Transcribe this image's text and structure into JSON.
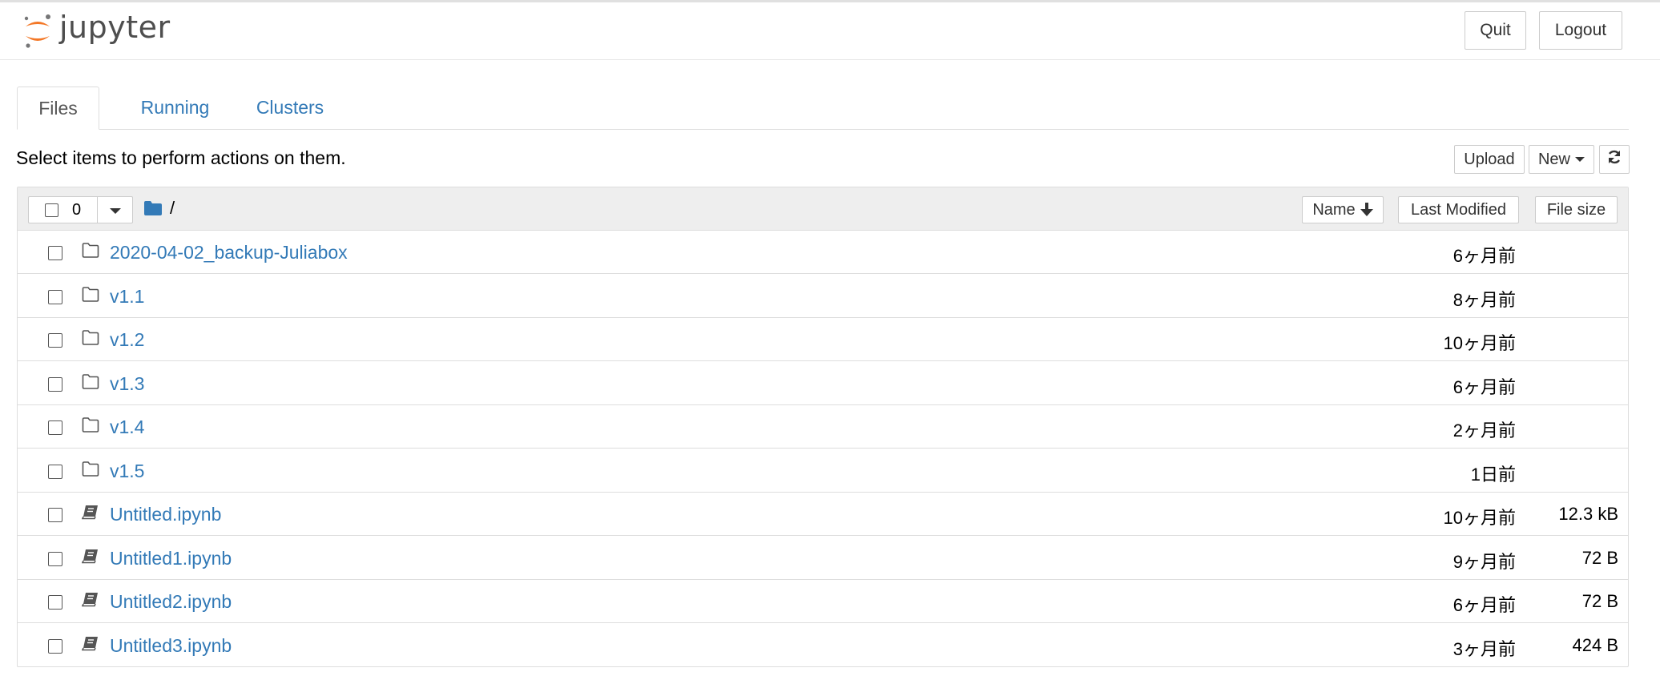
{
  "header": {
    "logo_text": "jupyter",
    "quit_label": "Quit",
    "logout_label": "Logout"
  },
  "tabs": [
    {
      "label": "Files",
      "active": true
    },
    {
      "label": "Running",
      "active": false
    },
    {
      "label": "Clusters",
      "active": false
    }
  ],
  "toolbar": {
    "hint": "Select items to perform actions on them.",
    "upload_label": "Upload",
    "new_label": "New",
    "refresh_icon": "refresh-icon"
  },
  "listing": {
    "selected_count": "0",
    "breadcrumb": "/",
    "columns": {
      "name": "Name",
      "last_modified": "Last Modified",
      "file_size": "File size"
    },
    "rows": [
      {
        "type": "folder",
        "name": "2020-04-02_backup-Juliabox",
        "modified": "6ヶ月前",
        "size": ""
      },
      {
        "type": "folder",
        "name": "v1.1",
        "modified": "8ヶ月前",
        "size": ""
      },
      {
        "type": "folder",
        "name": "v1.2",
        "modified": "10ヶ月前",
        "size": ""
      },
      {
        "type": "folder",
        "name": "v1.3",
        "modified": "6ヶ月前",
        "size": ""
      },
      {
        "type": "folder",
        "name": "v1.4",
        "modified": "2ヶ月前",
        "size": ""
      },
      {
        "type": "folder",
        "name": "v1.5",
        "modified": "1日前",
        "size": ""
      },
      {
        "type": "notebook",
        "name": "Untitled.ipynb",
        "modified": "10ヶ月前",
        "size": "12.3 kB"
      },
      {
        "type": "notebook",
        "name": "Untitled1.ipynb",
        "modified": "9ヶ月前",
        "size": "72 B"
      },
      {
        "type": "notebook",
        "name": "Untitled2.ipynb",
        "modified": "6ヶ月前",
        "size": "72 B"
      },
      {
        "type": "notebook",
        "name": "Untitled3.ipynb",
        "modified": "3ヶ月前",
        "size": "424 B"
      }
    ]
  },
  "colors": {
    "link": "#337ab7",
    "logo_orange": "#f37726",
    "logo_gray": "#767677",
    "border": "#dddddd",
    "header_bg": "#eeeeee"
  }
}
